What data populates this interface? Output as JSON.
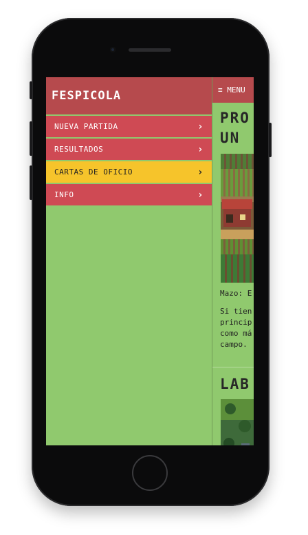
{
  "drawer": {
    "brand": "FESPICOLA",
    "items": [
      {
        "label": "NUEVA PARTIDA",
        "active": false
      },
      {
        "label": "RESULTADOS",
        "active": false
      },
      {
        "label": "CARTAS DE OFICIO",
        "active": true
      },
      {
        "label": "INFO",
        "active": false
      }
    ]
  },
  "topbar": {
    "menu_label": "≡ MENU"
  },
  "card1": {
    "title": "PRO\nUN",
    "deck_label": "Mazo: E",
    "lines": [
      "Si tien",
      "princip",
      "como má",
      "campo."
    ]
  },
  "card2": {
    "title": "LAB"
  },
  "colors": {
    "brand": "#b64a4d",
    "menu_item": "#cf4a54",
    "menu_active": "#f6c42b",
    "background": "#90c96e"
  },
  "icons": [
    "chevron-right-icon",
    "hamburger-icon"
  ]
}
